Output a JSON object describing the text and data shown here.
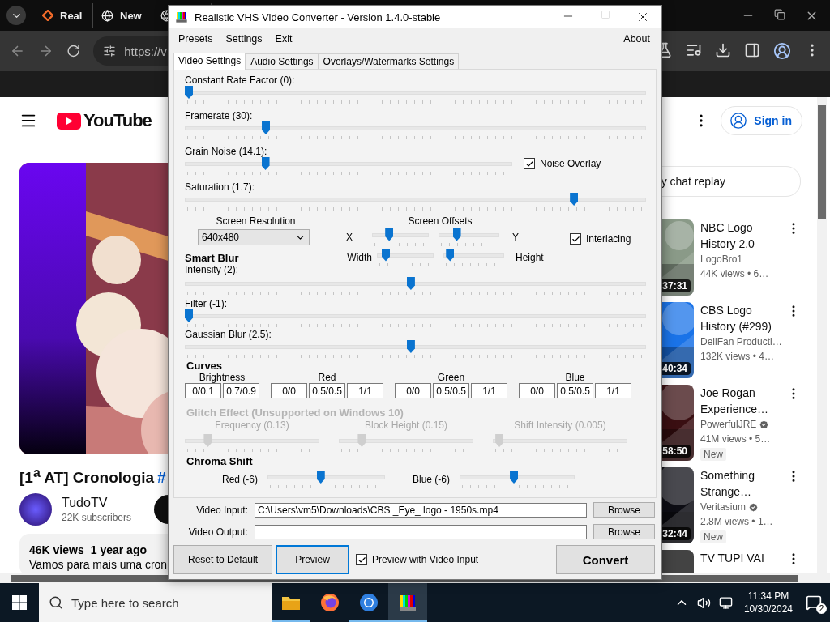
{
  "browser": {
    "tabs": [
      {
        "kind": "diamond",
        "label": "Real"
      },
      {
        "kind": "globe",
        "label": "New"
      },
      {
        "kind": "aperture"
      }
    ],
    "address": "https://v"
  },
  "youtube": {
    "logo": "YouTube",
    "sign_in": "Sign in",
    "chat_replay": "y chat replay",
    "video": {
      "title": "[1$^{a}$ AT] Cronologia",
      "hashtag": "#",
      "channel": "TudoTV",
      "subscribers": "22K subscribers",
      "views": "46K views",
      "age": "1 year ago",
      "description": "Vamos para mais uma cron"
    },
    "recommendations": [
      {
        "title": "NBC Logo History 2.0",
        "channel": "LogoBro1",
        "verified": false,
        "meta": "44K views  • 6…",
        "duration": "37:31"
      },
      {
        "title": "CBS Logo History (#299)",
        "channel": "DellFan Producti…",
        "verified": false,
        "meta": "132K views  • 4…",
        "duration": "40:34"
      },
      {
        "title": "Joe Rogan Experience…",
        "channel": "PowerfulJRE",
        "verified": true,
        "meta": "41M views  • 5…",
        "badge": "New",
        "duration": "58:50"
      },
      {
        "title": "Something Strange…",
        "channel": "Veritasium",
        "verified": true,
        "meta": "2.8M views  • 1…",
        "badge": "New",
        "duration": "32:44"
      },
      {
        "title": "TV TUPI VAI"
      }
    ]
  },
  "converter": {
    "title": "Realistic VHS Video Converter - Version 1.4.0-stable",
    "maximize_disabled": true,
    "menu": [
      "Presets",
      "Settings",
      "Exit"
    ],
    "menu_right": "About",
    "tabs": [
      {
        "label": "Video Settings",
        "selected": true
      },
      {
        "label": "Audio Settings",
        "selected": false
      },
      {
        "label": "Overlays/Watermarks Settings",
        "selected": false
      }
    ],
    "sliders": [
      {
        "label": "Constant Rate Factor (0):",
        "level": 0
      },
      {
        "label": "Framerate (30):",
        "level": 0.17
      },
      {
        "label": "Grain Noise (14.1):",
        "level": 0.24,
        "checkbox": {
          "label": "Noise Overlay",
          "checked": true
        }
      },
      {
        "label": "Saturation (1.7):",
        "level": 0.85
      }
    ],
    "resolution": {
      "label": "Screen Resolution",
      "value": "640x480"
    },
    "offsets": {
      "title": "Screen Offsets",
      "rows": [
        {
          "left_label": "X",
          "right_label": "Y",
          "left": {
            "level": 0.27
          },
          "right": {
            "level": 0.27
          }
        },
        {
          "left_label": "Width",
          "right_label": "Height",
          "left": {
            "level": 0.1
          },
          "right": {
            "level": 0.05
          }
        }
      ]
    },
    "interlacing": {
      "label": "Interlacing",
      "checked": true
    },
    "smart_blur": {
      "title": "Smart Blur",
      "label": "Intensity (2):",
      "level": 0.49
    },
    "more_sliders": [
      {
        "label": "Filter (-1):",
        "level": 0
      },
      {
        "label": "Gaussian Blur (2.5):",
        "level": 0.49
      }
    ],
    "curves": {
      "title": "Curves",
      "groups": [
        {
          "label": "Brightness",
          "values": [
            "0/0.1",
            "0.7/0.9"
          ]
        },
        {
          "label": "Red",
          "values": [
            "0/0",
            "0.5/0.5",
            "1/1"
          ]
        },
        {
          "label": "Green",
          "values": [
            "0/0",
            "0.5/0.5",
            "1/1"
          ]
        },
        {
          "label": "Blue",
          "values": [
            "0/0",
            "0.5/0.5",
            "1/1"
          ]
        }
      ]
    },
    "glitch": {
      "title": "Glitch Effect (Unsupported on Windows 10)",
      "disabled": true,
      "sliders": [
        {
          "label": "Frequency (0.13)",
          "level": 0.15
        },
        {
          "label": "Block Height (0.15)",
          "level": 0.15
        },
        {
          "label": "Shift Intensity (0.005)",
          "level": 0.02
        }
      ]
    },
    "chroma_shift": {
      "title": "Chroma Shift",
      "sliders": [
        {
          "label": "Red (-6)",
          "level": 0.45
        },
        {
          "label": "Blue (-6)",
          "level": 0.47
        }
      ]
    },
    "files": [
      {
        "label": "Video Input:",
        "value": "C:\\Users\\vm5\\Downloads\\CBS _Eye_ logo - 1950s.mp4",
        "button": "Browse"
      },
      {
        "label": "Video Output:",
        "button": "Browse"
      }
    ],
    "actions": {
      "reset": "Reset to Default",
      "preview": {
        "label": "Preview",
        "focused": true
      },
      "preview_input": {
        "label": "Preview with Video Input",
        "checked": true
      },
      "convert": "Convert"
    }
  },
  "taskbar": {
    "search": {
      "placeholder": "Type here to search"
    },
    "apps": [
      {
        "kind": "files",
        "running": true,
        "selected": false
      },
      {
        "kind": "firefox",
        "running": false,
        "selected": false
      },
      {
        "kind": "chrome",
        "running": true,
        "selected": false
      },
      {
        "kind": "vhs",
        "running": true,
        "selected": true
      }
    ],
    "time": "11:34 PM",
    "date": "10/30/2024",
    "notifications": "2"
  }
}
